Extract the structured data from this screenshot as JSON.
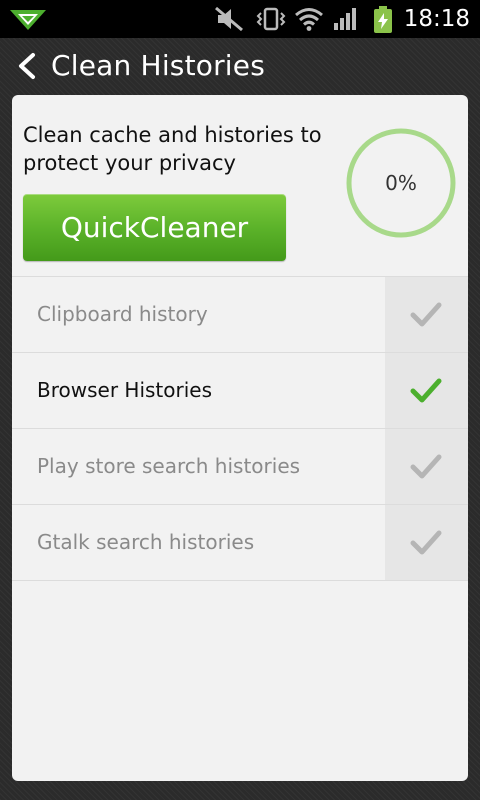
{
  "status_bar": {
    "time": "18:18",
    "icons": [
      "app-notification-icon",
      "mute-icon",
      "vibrate-icon",
      "wifi-icon",
      "signal-icon",
      "battery-charging-icon"
    ]
  },
  "title_bar": {
    "title": "Clean Histories",
    "back_icon": "chevron-left-icon"
  },
  "cleaner": {
    "description": "Clean cache and histories to protect your privacy",
    "button_label": "QuickCleaner",
    "progress_text": "0%",
    "progress_value": 0,
    "ring_color": "#a8d98a",
    "button_color": "#5cb32a"
  },
  "items": [
    {
      "label": "Clipboard history",
      "checked": false
    },
    {
      "label": "Browser Histories",
      "checked": true
    },
    {
      "label": "Play store search histories",
      "checked": false
    },
    {
      "label": "Gtalk search histories",
      "checked": false
    }
  ],
  "colors": {
    "check_on": "#4caf2e",
    "check_off": "#b5b5b5"
  }
}
